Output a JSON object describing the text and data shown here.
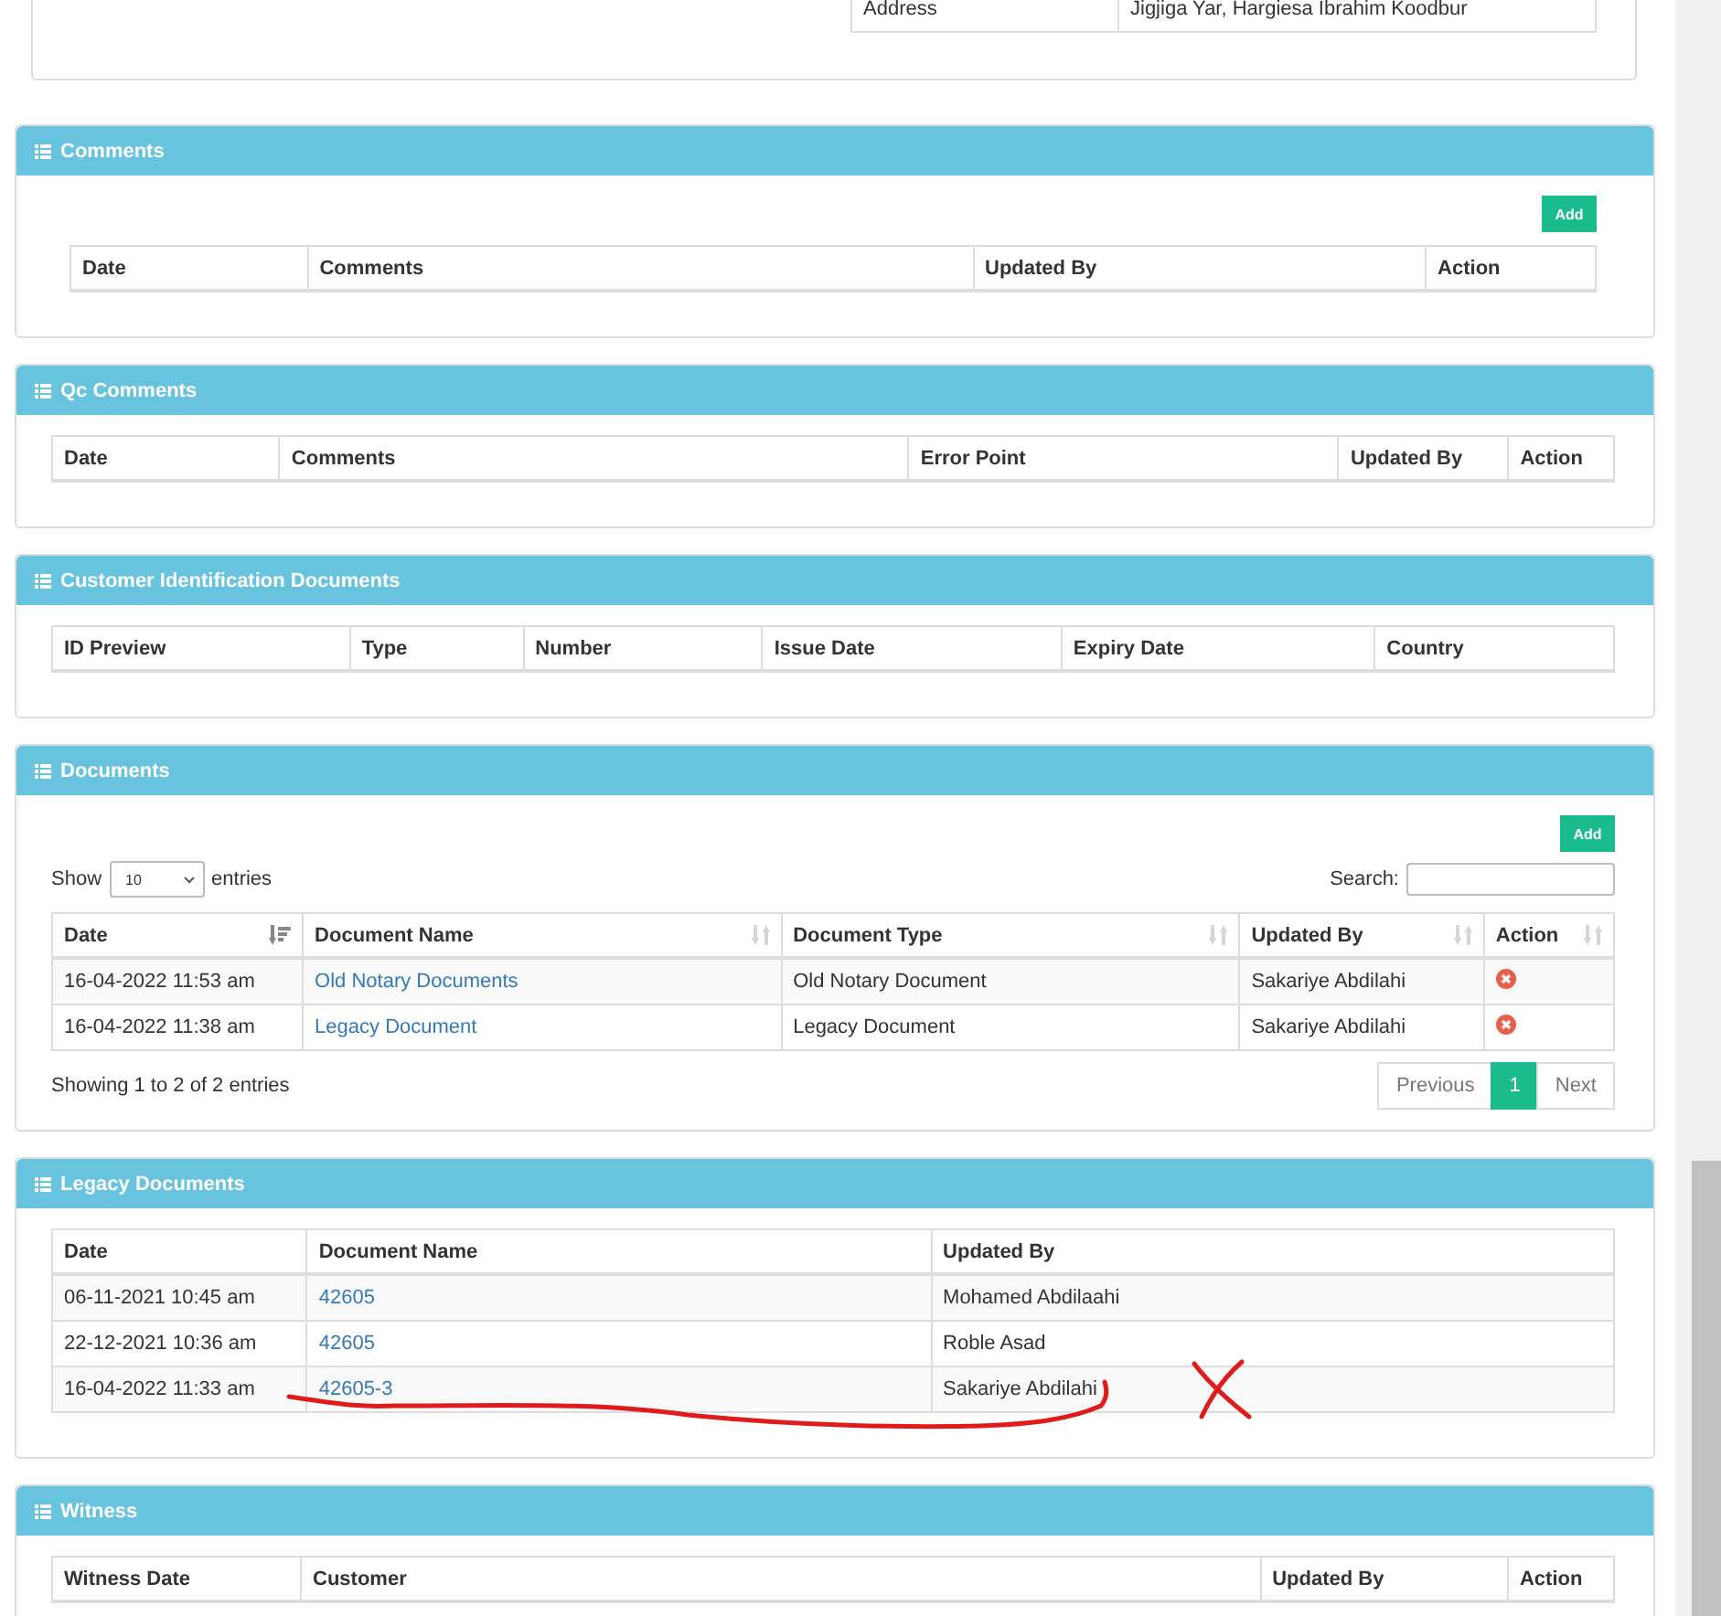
{
  "top_details": {
    "rows": [
      {
        "label": "Address",
        "value": "Jigjiga Yar, Hargiesa Ibrahim Koodbur"
      }
    ]
  },
  "panels": [
    {
      "title": "Comments",
      "add_button": "Add",
      "columns": [
        {
          "label": "Date"
        },
        {
          "label": "Comments"
        },
        {
          "label": "Updated By"
        },
        {
          "label": "Action"
        }
      ]
    },
    {
      "title": "Qc Comments",
      "columns": [
        {
          "label": "Date"
        },
        {
          "label": "Comments"
        },
        {
          "label": "Error Point"
        },
        {
          "label": "Updated By"
        },
        {
          "label": "Action"
        }
      ]
    },
    {
      "title": "Customer Identification Documents",
      "columns": [
        {
          "label": "ID Preview"
        },
        {
          "label": "Type"
        },
        {
          "label": "Number"
        },
        {
          "label": "Issue Date"
        },
        {
          "label": "Expiry Date"
        },
        {
          "label": "Country"
        }
      ]
    },
    {
      "title": "Documents",
      "add_button": "Add",
      "show_label": "Show",
      "page_length": "10",
      "entries_label": "entries",
      "search_label": "Search:",
      "columns": [
        {
          "label": "Date",
          "sorted": true
        },
        {
          "label": "Document Name",
          "sorted": false
        },
        {
          "label": "Document Type",
          "sorted": false
        },
        {
          "label": "Updated By",
          "sorted": false
        },
        {
          "label": "Action",
          "sorted": false
        }
      ],
      "rows": [
        [
          {
            "kind": "text",
            "text": "16-04-2022 11:53 am"
          },
          {
            "kind": "link",
            "text": "Old Notary Documents"
          },
          {
            "kind": "text",
            "text": "Old Notary Document"
          },
          {
            "kind": "text",
            "text": "Sakariye Abdilahi"
          },
          {
            "kind": "delete"
          }
        ],
        [
          {
            "kind": "text",
            "text": "16-04-2022 11:38 am"
          },
          {
            "kind": "link",
            "text": "Legacy Document"
          },
          {
            "kind": "text",
            "text": "Legacy Document"
          },
          {
            "kind": "text",
            "text": "Sakariye Abdilahi"
          },
          {
            "kind": "delete"
          }
        ]
      ],
      "info": "Showing 1 to 2 of 2 entries",
      "pagination": [
        {
          "label": "Previous",
          "selected": false
        },
        {
          "label": "1",
          "selected": true
        },
        {
          "label": "Next",
          "selected": false
        }
      ]
    },
    {
      "title": "Legacy Documents",
      "columns": [
        {
          "label": "Date"
        },
        {
          "label": "Document Name"
        },
        {
          "label": "Updated By"
        }
      ],
      "rows": [
        [
          {
            "kind": "text",
            "text": "06-11-2021 10:45 am"
          },
          {
            "kind": "link",
            "text": "42605"
          },
          {
            "kind": "text",
            "text": "Mohamed Abdilaahi"
          }
        ],
        [
          {
            "kind": "text",
            "text": "22-12-2021 10:36 am"
          },
          {
            "kind": "link",
            "text": "42605"
          },
          {
            "kind": "text",
            "text": "Roble Asad"
          }
        ],
        [
          {
            "kind": "text",
            "text": "16-04-2022 11:33 am"
          },
          {
            "kind": "link",
            "text": "42605-3"
          },
          {
            "kind": "text",
            "text": "Sakariye Abdilahi"
          }
        ]
      ],
      "scribble": true
    },
    {
      "title": "Witness",
      "columns": [
        {
          "label": "Witness Date"
        },
        {
          "label": "Customer"
        },
        {
          "label": "Updated By"
        },
        {
          "label": "Action"
        }
      ]
    }
  ]
}
